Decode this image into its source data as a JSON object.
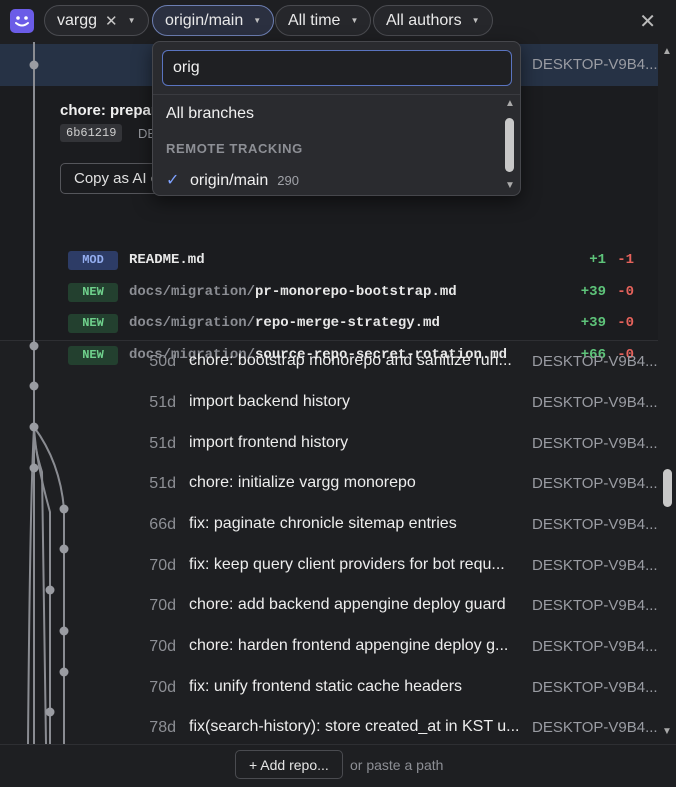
{
  "filters": {
    "repo": {
      "label": "vargg",
      "icon": "app-logo-icon"
    },
    "branch": {
      "label": "origin/main"
    },
    "time": {
      "label": "All time"
    },
    "authors": {
      "label": "All authors"
    }
  },
  "selected_commit": {
    "author": "DESKTOP-V9B4...",
    "title": "chore: prepar",
    "hash": "6b61219",
    "hash_after": "DE",
    "copy_button": "Copy as AI c",
    "files": [
      {
        "status": "MOD",
        "dir": "",
        "name": "README.md",
        "adds": "+1",
        "dels": "-1"
      },
      {
        "status": "NEW",
        "dir": "docs/migration/",
        "name": "pr-monorepo-bootstrap.md",
        "adds": "+39",
        "dels": "-0"
      },
      {
        "status": "NEW",
        "dir": "docs/migration/",
        "name": "repo-merge-strategy.md",
        "adds": "+39",
        "dels": "-0"
      },
      {
        "status": "NEW",
        "dir": "docs/migration/",
        "name": "source-repo-secret-rotation.md",
        "adds": "+66",
        "dels": "-0"
      }
    ]
  },
  "commits": [
    {
      "age": "50d",
      "message": "chore: bootstrap monorepo and sanitize run...",
      "author": "DESKTOP-V9B4..."
    },
    {
      "age": "51d",
      "message": "import backend history",
      "author": "DESKTOP-V9B4..."
    },
    {
      "age": "51d",
      "message": "import frontend history",
      "author": "DESKTOP-V9B4..."
    },
    {
      "age": "51d",
      "message": "chore: initialize vargg monorepo",
      "author": "DESKTOP-V9B4..."
    },
    {
      "age": "66d",
      "message": "fix: paginate chronicle sitemap entries",
      "author": "DESKTOP-V9B4..."
    },
    {
      "age": "70d",
      "message": "fix: keep query client providers for bot requ...",
      "author": "DESKTOP-V9B4..."
    },
    {
      "age": "70d",
      "message": "chore: add backend appengine deploy guard",
      "author": "DESKTOP-V9B4..."
    },
    {
      "age": "70d",
      "message": "chore: harden frontend appengine deploy g...",
      "author": "DESKTOP-V9B4..."
    },
    {
      "age": "70d",
      "message": "fix: unify frontend static cache headers",
      "author": "DESKTOP-V9B4..."
    },
    {
      "age": "78d",
      "message": "fix(search-history): store created_at in KST u...",
      "author": "DESKTOP-V9B4..."
    }
  ],
  "footer": {
    "add_repo": "+ Add repo...",
    "paste_hint": "or paste a path"
  },
  "branch_dropdown": {
    "search_value": "orig",
    "all_branches": "All branches",
    "section_label": "REMOTE TRACKING",
    "branches": [
      {
        "name": "origin/main",
        "count": "290",
        "checked": true
      }
    ]
  },
  "colors": {
    "accent": "#7fa2ff",
    "additions": "#5ec47a",
    "deletions": "#e5625b",
    "mod_badge": "#94aef0",
    "new_badge": "#6fd08c"
  }
}
